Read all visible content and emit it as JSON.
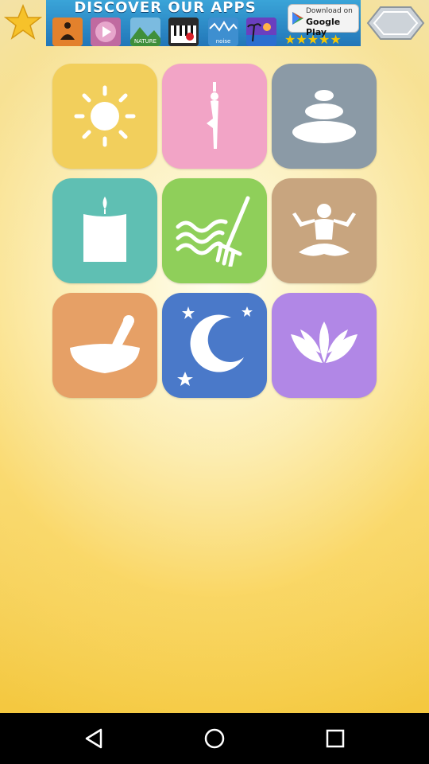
{
  "banner": {
    "title": "DISCOVER OUR APPS",
    "apps": [
      {
        "label": "",
        "color": "#d86a2a"
      },
      {
        "label": "",
        "color": "#b04c8a"
      },
      {
        "label": "NATURE",
        "color": "#3a8b3d"
      },
      {
        "label": "",
        "color": "#222222"
      },
      {
        "label": "noise",
        "color": "#1d6fb0"
      },
      {
        "label": "",
        "color": "#5a3fb4"
      }
    ],
    "store_line1": "Download on",
    "store_line2": "Google Play",
    "rating": "★★★★★"
  },
  "top_icons": {
    "favorite": "star-icon",
    "navigation": "double-chevron-icon"
  },
  "tiles": [
    {
      "name": "sun",
      "color": "#f2cf5c",
      "icon": "sun-icon"
    },
    {
      "name": "yoga-tree-pose",
      "color": "#f2a4c6",
      "icon": "yoga-tree-pose-icon"
    },
    {
      "name": "stacked-stones",
      "color": "#8b9aa6",
      "icon": "stacked-stones-icon"
    },
    {
      "name": "candle",
      "color": "#5fbfb3",
      "icon": "candle-icon"
    },
    {
      "name": "zen-garden-rake",
      "color": "#8fcf5a",
      "icon": "zen-rake-icon"
    },
    {
      "name": "meditation-pose",
      "color": "#c8a57f",
      "icon": "meditation-pose-icon"
    },
    {
      "name": "mortar-pestle",
      "color": "#e6a066",
      "icon": "mortar-pestle-icon"
    },
    {
      "name": "moon-stars",
      "color": "#4a79c9",
      "icon": "moon-stars-icon"
    },
    {
      "name": "lotus",
      "color": "#b187e6",
      "icon": "lotus-icon"
    }
  ],
  "system_nav": {
    "back": "back-icon",
    "home": "home-icon",
    "recents": "recents-icon"
  }
}
